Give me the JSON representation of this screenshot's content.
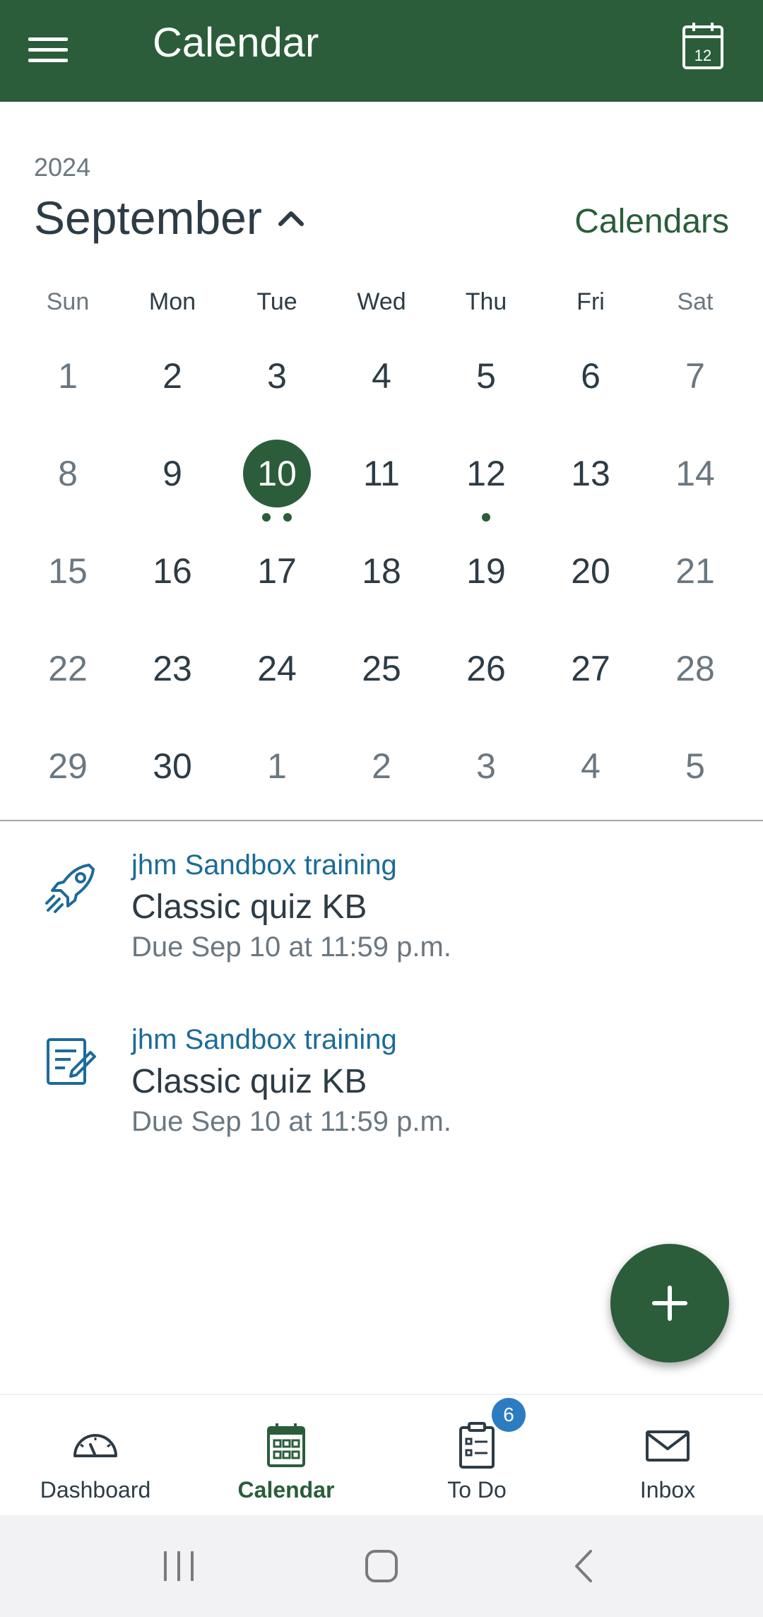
{
  "appbar": {
    "title": "Calendar",
    "today_number": "12"
  },
  "header": {
    "year": "2024",
    "month": "September",
    "calendars_label": "Calendars"
  },
  "weekdays": [
    "Sun",
    "Mon",
    "Tue",
    "Wed",
    "Thu",
    "Fri",
    "Sat"
  ],
  "days": [
    {
      "label": "1",
      "other": false
    },
    {
      "label": "2",
      "other": false
    },
    {
      "label": "3",
      "other": false
    },
    {
      "label": "4",
      "other": false
    },
    {
      "label": "5",
      "other": false
    },
    {
      "label": "6",
      "other": false
    },
    {
      "label": "7",
      "other": false
    },
    {
      "label": "8",
      "other": false
    },
    {
      "label": "9",
      "other": false
    },
    {
      "label": "10",
      "other": false,
      "selected": true,
      "dots": 2
    },
    {
      "label": "11",
      "other": false
    },
    {
      "label": "12",
      "other": false,
      "dots": 1
    },
    {
      "label": "13",
      "other": false
    },
    {
      "label": "14",
      "other": false
    },
    {
      "label": "15",
      "other": false
    },
    {
      "label": "16",
      "other": false
    },
    {
      "label": "17",
      "other": false
    },
    {
      "label": "18",
      "other": false
    },
    {
      "label": "19",
      "other": false
    },
    {
      "label": "20",
      "other": false
    },
    {
      "label": "21",
      "other": false
    },
    {
      "label": "22",
      "other": false
    },
    {
      "label": "23",
      "other": false
    },
    {
      "label": "24",
      "other": false
    },
    {
      "label": "25",
      "other": false
    },
    {
      "label": "26",
      "other": false
    },
    {
      "label": "27",
      "other": false
    },
    {
      "label": "28",
      "other": false
    },
    {
      "label": "29",
      "other": false
    },
    {
      "label": "30",
      "other": false
    },
    {
      "label": "1",
      "other": true
    },
    {
      "label": "2",
      "other": true
    },
    {
      "label": "3",
      "other": true
    },
    {
      "label": "4",
      "other": true
    },
    {
      "label": "5",
      "other": true
    }
  ],
  "events": [
    {
      "icon": "rocket-icon",
      "course": "jhm Sandbox training",
      "name": "Classic quiz KB",
      "due": "Due Sep 10 at 11:59 p.m."
    },
    {
      "icon": "quiz-icon",
      "course": "jhm Sandbox training",
      "name": "Classic quiz KB",
      "due": "Due Sep 10 at 11:59 p.m."
    }
  ],
  "nav": [
    {
      "label": "Dashboard",
      "icon": "dashboard-icon"
    },
    {
      "label": "Calendar",
      "icon": "calendar-icon",
      "active": true
    },
    {
      "label": "To Do",
      "icon": "todo-icon",
      "badge": "6"
    },
    {
      "label": "Inbox",
      "icon": "inbox-icon"
    }
  ],
  "colors": {
    "brand": "#2b5d3a",
    "link": "#1c6b98",
    "badge": "#2c7cc1",
    "muted": "#6b7780",
    "text": "#2d3b45"
  }
}
